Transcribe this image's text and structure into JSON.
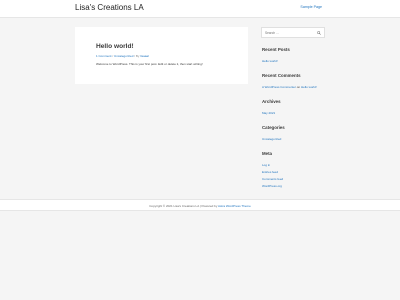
{
  "header": {
    "site_title": "Lisa's Creations LA",
    "nav_link": "Sample Page"
  },
  "post": {
    "title": "Hello world!",
    "comment_link": "1 Comment",
    "meta_sep1": " / ",
    "category_link": "Uncategorized",
    "meta_sep2": " / By ",
    "author_link": "lisaaal",
    "excerpt": "Welcome to WordPress. This is your first post. Edit or delete it, then start writing!"
  },
  "sidebar": {
    "search_placeholder": "Search …",
    "recent_posts_title": "Recent Posts",
    "recent_posts": [
      "Hello world!"
    ],
    "recent_comments_title": "Recent Comments",
    "recent_comment_author": "A WordPress Commenter",
    "recent_comment_on": " on ",
    "recent_comment_post": "Hello world!",
    "archives_title": "Archives",
    "archives": [
      "May 2021"
    ],
    "categories_title": "Categories",
    "categories": [
      "Uncategorized"
    ],
    "meta_title": "Meta",
    "meta_links": [
      "Log in",
      "Entries feed",
      "Comments feed",
      "WordPress.org"
    ]
  },
  "footer": {
    "copyright": "Copyright © 2021 Lisa's Creations LA | Powered by ",
    "theme_link": "Astra WordPress Theme"
  },
  "colors": {
    "link": "#1e73be",
    "background": "#f5f5f5",
    "card": "#ffffff"
  }
}
